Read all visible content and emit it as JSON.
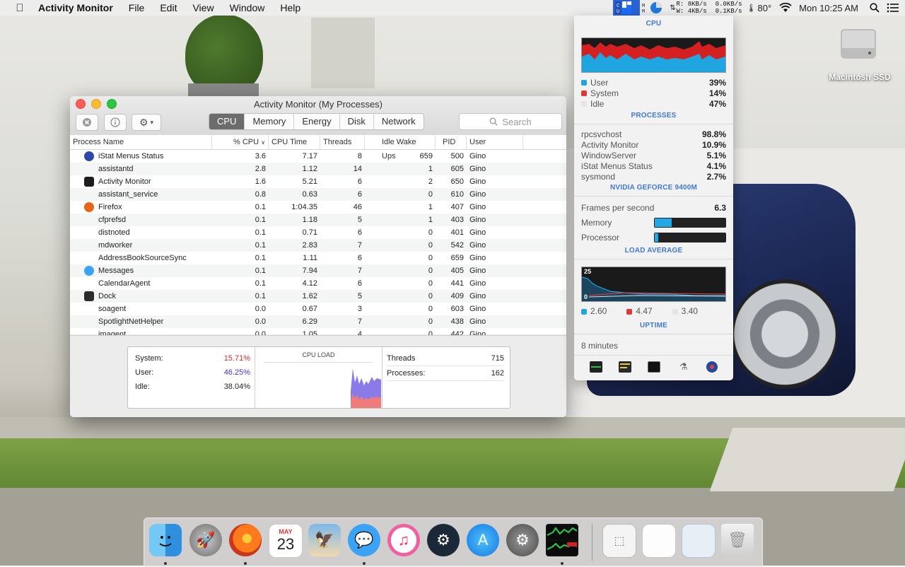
{
  "menubar": {
    "app_name": "Activity Monitor",
    "menus": [
      "File",
      "Edit",
      "View",
      "Window",
      "Help"
    ],
    "net_r": "8KB/s",
    "net_w": "4KB/s",
    "disk_r": "0.0KB/s",
    "disk_w": "0.1KB/s",
    "label_r": "R:",
    "label_w": "W:",
    "temp": "80°",
    "clock": "Mon 10:25 AM"
  },
  "window": {
    "title": "Activity Monitor (My Processes)",
    "tabs": [
      "CPU",
      "Memory",
      "Energy",
      "Disk",
      "Network"
    ],
    "selected_tab": "CPU",
    "search_placeholder": "Search",
    "columns": [
      "Process Name",
      "% CPU",
      "CPU Time",
      "Threads",
      "Idle Wake Ups",
      "PID",
      "User"
    ],
    "processes": [
      {
        "name": "iStat Menus Status",
        "cpu": "3.6",
        "time": "7.17",
        "threads": "8",
        "wake": "659",
        "pid": "500",
        "user": "Gino",
        "icon": "istat-icon",
        "color": "#2b4aa8"
      },
      {
        "name": "assistantd",
        "cpu": "2.8",
        "time": "1.12",
        "threads": "14",
        "wake": "1",
        "pid": "605",
        "user": "Gino",
        "icon": "",
        "color": ""
      },
      {
        "name": "Activity Monitor",
        "cpu": "1.6",
        "time": "5.21",
        "threads": "6",
        "wake": "2",
        "pid": "650",
        "user": "Gino",
        "icon": "activity-monitor-icon",
        "color": "#1d1d1d"
      },
      {
        "name": "assistant_service",
        "cpu": "0.8",
        "time": "0.63",
        "threads": "6",
        "wake": "0",
        "pid": "610",
        "user": "Gino",
        "icon": "",
        "color": ""
      },
      {
        "name": "Firefox",
        "cpu": "0.1",
        "time": "1:04.35",
        "threads": "46",
        "wake": "1",
        "pid": "407",
        "user": "Gino",
        "icon": "firefox-icon",
        "color": "#e8641b"
      },
      {
        "name": "cfprefsd",
        "cpu": "0.1",
        "time": "1.18",
        "threads": "5",
        "wake": "1",
        "pid": "403",
        "user": "Gino",
        "icon": "",
        "color": ""
      },
      {
        "name": "distnoted",
        "cpu": "0.1",
        "time": "0.71",
        "threads": "6",
        "wake": "0",
        "pid": "401",
        "user": "Gino",
        "icon": "",
        "color": ""
      },
      {
        "name": "mdworker",
        "cpu": "0.1",
        "time": "2.83",
        "threads": "7",
        "wake": "0",
        "pid": "542",
        "user": "Gino",
        "icon": "",
        "color": ""
      },
      {
        "name": "AddressBookSourceSync",
        "cpu": "0.1",
        "time": "1.11",
        "threads": "6",
        "wake": "0",
        "pid": "659",
        "user": "Gino",
        "icon": "",
        "color": ""
      },
      {
        "name": "Messages",
        "cpu": "0.1",
        "time": "7.94",
        "threads": "7",
        "wake": "0",
        "pid": "405",
        "user": "Gino",
        "icon": "messages-icon",
        "color": "#3aa3f5"
      },
      {
        "name": "CalendarAgent",
        "cpu": "0.1",
        "time": "4.12",
        "threads": "6",
        "wake": "0",
        "pid": "441",
        "user": "Gino",
        "icon": "",
        "color": ""
      },
      {
        "name": "Dock",
        "cpu": "0.1",
        "time": "1.62",
        "threads": "5",
        "wake": "0",
        "pid": "409",
        "user": "Gino",
        "icon": "dock-icon",
        "color": "#2b2b2b"
      },
      {
        "name": "soagent",
        "cpu": "0.0",
        "time": "0.67",
        "threads": "3",
        "wake": "0",
        "pid": "603",
        "user": "Gino",
        "icon": "",
        "color": ""
      },
      {
        "name": "SpotlightNetHelper",
        "cpu": "0.0",
        "time": "6.29",
        "threads": "7",
        "wake": "0",
        "pid": "438",
        "user": "Gino",
        "icon": "",
        "color": ""
      },
      {
        "name": "imagent",
        "cpu": "0.0",
        "time": "1.05",
        "threads": "4",
        "wake": "0",
        "pid": "442",
        "user": "Gino",
        "icon": "",
        "color": ""
      }
    ],
    "summary": {
      "system_label": "System:",
      "system": "15.71%",
      "user_label": "User:",
      "user": "46.25%",
      "idle_label": "Idle:",
      "idle": "38.04%",
      "chart_title": "CPU LOAD",
      "threads_label": "Threads",
      "threads": "715",
      "processes_label": "Processes:",
      "processes": "162"
    }
  },
  "istat": {
    "cpu_title": "CPU",
    "user_label": "User",
    "user": "39%",
    "system_label": "System",
    "system": "14%",
    "idle_label": "Idle",
    "idle": "47%",
    "processes_title": "PROCESSES",
    "processes": [
      {
        "name": "rpcsvchost",
        "value": "98.8%"
      },
      {
        "name": "Activity Monitor",
        "value": "10.9%"
      },
      {
        "name": "WindowServer",
        "value": "5.1%"
      },
      {
        "name": "iStat Menus Status",
        "value": "4.1%"
      },
      {
        "name": "sysmond",
        "value": "2.7%"
      }
    ],
    "gpu_title": "NVIDIA GEFORCE 9400M",
    "fps_label": "Frames per second",
    "fps": "6.3",
    "memory_label": "Memory",
    "memory_fill": 0.24,
    "processor_label": "Processor",
    "processor_fill": 0.05,
    "load_title": "LOAD AVERAGE",
    "load_max": "25",
    "load_min": "0",
    "load1": "2.60",
    "load5": "4.47",
    "load15": "3.40",
    "uptime_title": "UPTIME",
    "uptime": "8 minutes"
  },
  "desktop": {
    "hdd_label": "Macintosh SSD"
  },
  "dock": {
    "calendar_month": "MAY",
    "calendar_day": "23"
  }
}
